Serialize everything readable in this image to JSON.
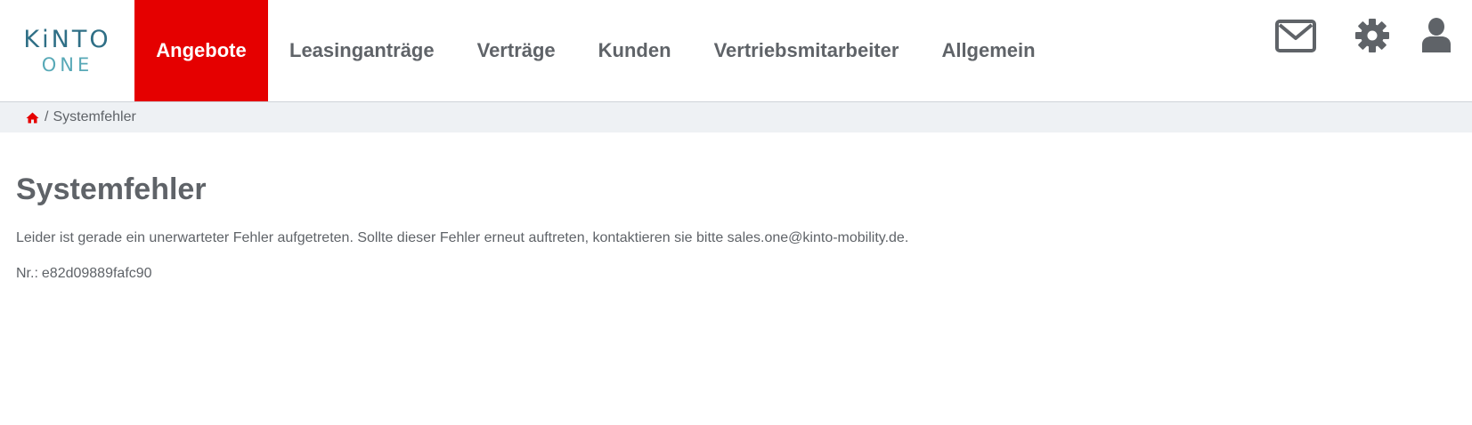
{
  "brand": {
    "logo_top": "KiNTO",
    "logo_bottom": "ONE",
    "accent_color": "#e50000",
    "logo_color": "#2f6f86",
    "logo_sub_color": "#58a9b7"
  },
  "nav": {
    "items": [
      {
        "label": "Angebote",
        "active": true
      },
      {
        "label": "Leasinganträge",
        "active": false
      },
      {
        "label": "Verträge",
        "active": false
      },
      {
        "label": "Kunden",
        "active": false
      },
      {
        "label": "Vertriebsmitarbeiter",
        "active": false
      },
      {
        "label": "Allgemein",
        "active": false
      }
    ]
  },
  "header_icons": [
    "mail-icon",
    "gear-icon",
    "user-icon"
  ],
  "breadcrumb": {
    "home_icon": "home-icon",
    "separator": "/",
    "current": "Systemfehler"
  },
  "main": {
    "title": "Systemfehler",
    "message": "Leider ist gerade ein unerwarteter Fehler aufgetreten. Sollte dieser Fehler erneut auftreten, kontaktieren sie bitte sales.one@kinto-mobility.de.",
    "nr_label": "Nr.:",
    "nr_value": "e82d09889fafc90"
  }
}
